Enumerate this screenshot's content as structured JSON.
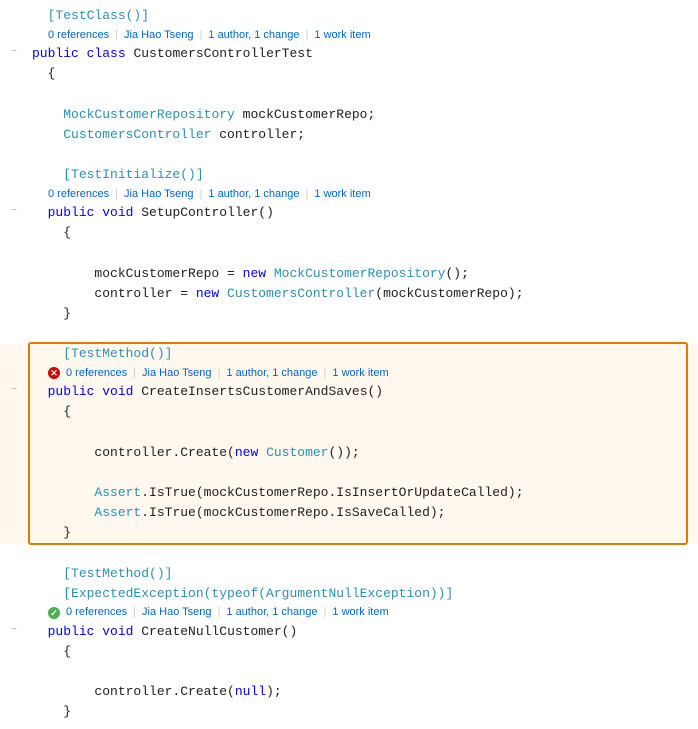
{
  "colors": {
    "keyword": "#0000ff",
    "type": "#2b91af",
    "string": "#a31515",
    "comment": "#57a64a",
    "plain": "#1e1e1e",
    "lens": "#767676",
    "lens_link": "#0066cc",
    "highlight_border": "#e07b00"
  },
  "lines": [
    {
      "id": "l1",
      "indent": 2,
      "collapse": false,
      "content": "[TestClass()]",
      "type": "attribute"
    },
    {
      "id": "l2",
      "indent": 2,
      "collapse": false,
      "content": "",
      "type": "lens",
      "lens": {
        "refs": "0 references",
        "author": "Jia Hao Tseng",
        "changes": "1 author, 1 change",
        "workitem": "1 work item"
      }
    },
    {
      "id": "l3",
      "indent": 0,
      "collapse": true,
      "content": "public class CustomersControllerTest",
      "type": "class_decl"
    },
    {
      "id": "l4",
      "indent": 2,
      "collapse": false,
      "content": "{",
      "type": "brace"
    },
    {
      "id": "l5",
      "indent": 0,
      "collapse": false,
      "content": "",
      "type": "blank"
    },
    {
      "id": "l6",
      "indent": 4,
      "collapse": false,
      "content": "MockCustomerRepository mockCustomerRepo;",
      "type": "field"
    },
    {
      "id": "l7",
      "indent": 4,
      "collapse": false,
      "content": "CustomersController controller;",
      "type": "field"
    },
    {
      "id": "l8",
      "indent": 0,
      "collapse": false,
      "content": "",
      "type": "blank"
    },
    {
      "id": "l9",
      "indent": 4,
      "collapse": false,
      "content": "[TestInitialize()]",
      "type": "attribute"
    },
    {
      "id": "l10",
      "indent": 4,
      "collapse": false,
      "content": "",
      "type": "lens",
      "lens": {
        "refs": "0 references",
        "author": "Jia Hao Tseng",
        "changes": "1 author, 1 change",
        "workitem": "1 work item"
      }
    },
    {
      "id": "l11",
      "indent": 2,
      "collapse": true,
      "content": "public void SetupController()",
      "type": "method_decl"
    },
    {
      "id": "l12",
      "indent": 4,
      "collapse": false,
      "content": "{",
      "type": "brace"
    },
    {
      "id": "l13",
      "indent": 0,
      "collapse": false,
      "content": "",
      "type": "blank"
    },
    {
      "id": "l14",
      "indent": 8,
      "collapse": false,
      "content": "mockCustomerRepo = new MockCustomerRepository();",
      "type": "stmt"
    },
    {
      "id": "l15",
      "indent": 8,
      "collapse": false,
      "content": "controller = new CustomersController(mockCustomerRepo);",
      "type": "stmt"
    },
    {
      "id": "l16",
      "indent": 4,
      "collapse": false,
      "content": "}",
      "type": "brace"
    },
    {
      "id": "l17",
      "indent": 0,
      "collapse": false,
      "content": "",
      "type": "blank"
    },
    {
      "id": "l18",
      "indent": 4,
      "collapse": false,
      "content": "[TestMethod()]",
      "type": "attribute",
      "highlighted": true
    },
    {
      "id": "l19",
      "indent": 4,
      "collapse": false,
      "content": "",
      "type": "lens_error",
      "highlighted": true,
      "lens": {
        "refs": "0 references",
        "author": "Jia Hao Tseng",
        "changes": "1 author, 1 change",
        "workitem": "1 work item"
      }
    },
    {
      "id": "l20",
      "indent": 2,
      "collapse": true,
      "content": "public void CreateInsertsCustomerAndSaves()",
      "type": "method_decl",
      "highlighted": true
    },
    {
      "id": "l21",
      "indent": 4,
      "collapse": false,
      "content": "{",
      "type": "brace",
      "highlighted": true
    },
    {
      "id": "l22",
      "indent": 0,
      "collapse": false,
      "content": "",
      "type": "blank",
      "highlighted": true
    },
    {
      "id": "l23",
      "indent": 8,
      "collapse": false,
      "content": "controller.Create(new Customer());",
      "type": "stmt",
      "highlighted": true
    },
    {
      "id": "l24",
      "indent": 0,
      "collapse": false,
      "content": "",
      "type": "blank",
      "highlighted": true
    },
    {
      "id": "l25",
      "indent": 8,
      "collapse": false,
      "content": "Assert.IsTrue(mockCustomerRepo.IsInsertOrUpdateCalled);",
      "type": "stmt",
      "highlighted": true
    },
    {
      "id": "l26",
      "indent": 8,
      "collapse": false,
      "content": "Assert.IsTrue(mockCustomerRepo.IsSaveCalled);",
      "type": "stmt",
      "highlighted": true
    },
    {
      "id": "l27",
      "indent": 4,
      "collapse": false,
      "content": "}",
      "type": "brace",
      "highlighted": true
    },
    {
      "id": "l28",
      "indent": 0,
      "collapse": false,
      "content": "",
      "type": "blank"
    },
    {
      "id": "l29",
      "indent": 4,
      "collapse": false,
      "content": "[TestMethod()]",
      "type": "attribute"
    },
    {
      "id": "l30",
      "indent": 4,
      "collapse": false,
      "content": "[ExpectedException(typeof(ArgumentNullException))]",
      "type": "attribute"
    },
    {
      "id": "l31",
      "indent": 4,
      "collapse": false,
      "content": "",
      "type": "lens_ok",
      "lens": {
        "refs": "0 references",
        "author": "Jia Hao Tseng",
        "changes": "1 author, 1 change",
        "workitem": "1 work item"
      }
    },
    {
      "id": "l32",
      "indent": 2,
      "collapse": true,
      "content": "public void CreateNullCustomer()",
      "type": "method_decl"
    },
    {
      "id": "l33",
      "indent": 4,
      "collapse": false,
      "content": "{",
      "type": "brace"
    },
    {
      "id": "l34",
      "indent": 0,
      "collapse": false,
      "content": "",
      "type": "blank"
    },
    {
      "id": "l35",
      "indent": 8,
      "collapse": false,
      "content": "controller.Create(null);",
      "type": "stmt"
    },
    {
      "id": "l36",
      "indent": 4,
      "collapse": false,
      "content": "}",
      "type": "brace"
    }
  ]
}
